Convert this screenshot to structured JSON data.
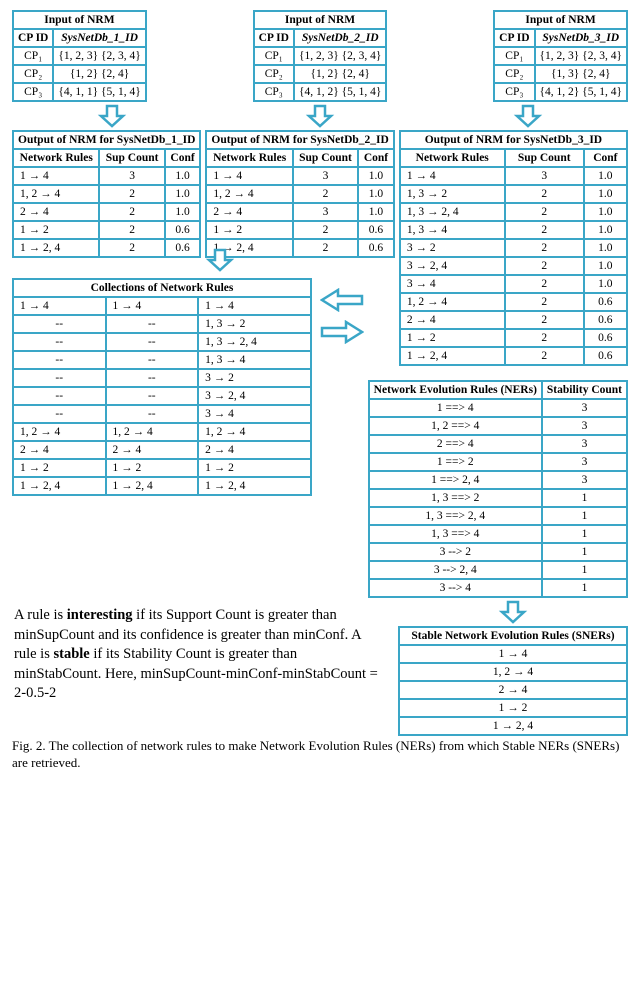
{
  "inputTables": [
    {
      "title": "Input of NRM",
      "col1": "CP ID",
      "col2": "SysNetDb_1_ID",
      "rows": [
        {
          "cp": "CP₁",
          "val": "{1, 2, 3} {2, 3, 4}"
        },
        {
          "cp": "CP₂",
          "val": "{1, 2} {2, 4}"
        },
        {
          "cp": "CP₃",
          "val": "{4, 1, 1} {5, 1, 4}"
        }
      ]
    },
    {
      "title": "Input of NRM",
      "col1": "CP ID",
      "col2": "SysNetDb_2_ID",
      "rows": [
        {
          "cp": "CP₁",
          "val": "{1, 2, 3} {2, 3, 4}"
        },
        {
          "cp": "CP₂",
          "val": "{1, 2} {2, 4}"
        },
        {
          "cp": "CP₃",
          "val": "{4, 1, 2} {5, 1, 4}"
        }
      ]
    },
    {
      "title": "Input of NRM",
      "col1": "CP ID",
      "col2": "SysNetDb_3_ID",
      "rows": [
        {
          "cp": "CP₁",
          "val": "{1, 2, 3} {2, 3, 4}"
        },
        {
          "cp": "CP₂",
          "val": "{1, 3} {2, 4}"
        },
        {
          "cp": "CP₃",
          "val": "{4, 1, 2} {5, 1, 4}"
        }
      ]
    }
  ],
  "outputTables": [
    {
      "title": "Output of NRM for SysNetDb_1_ID",
      "headers": [
        "Network Rules",
        "Sup Count",
        "Conf"
      ],
      "rows": [
        {
          "r": "1 → 4",
          "s": "3",
          "c": "1.0"
        },
        {
          "r": "1, 2 → 4",
          "s": "2",
          "c": "1.0"
        },
        {
          "r": "2 → 4",
          "s": "2",
          "c": "1.0"
        },
        {
          "r": "1 → 2",
          "s": "2",
          "c": "0.6"
        },
        {
          "r": "1 → 2, 4",
          "s": "2",
          "c": "0.6"
        }
      ]
    },
    {
      "title": "Output of NRM for SysNetDb_2_ID",
      "headers": [
        "Network Rules",
        "Sup Count",
        "Conf"
      ],
      "rows": [
        {
          "r": "1 → 4",
          "s": "3",
          "c": "1.0"
        },
        {
          "r": "1, 2 → 4",
          "s": "2",
          "c": "1.0"
        },
        {
          "r": "2 → 4",
          "s": "3",
          "c": "1.0"
        },
        {
          "r": "1 → 2",
          "s": "2",
          "c": "0.6"
        },
        {
          "r": "1 → 2, 4",
          "s": "2",
          "c": "0.6"
        }
      ]
    },
    {
      "title": "Output of NRM for SysNetDb_3_ID",
      "headers": [
        "Network Rules",
        "Sup Count",
        "Conf"
      ],
      "rows": [
        {
          "r": "1 → 4",
          "s": "3",
          "c": "1.0"
        },
        {
          "r": "1, 3 → 2",
          "s": "2",
          "c": "1.0"
        },
        {
          "r": "1, 3 → 2, 4",
          "s": "2",
          "c": "1.0"
        },
        {
          "r": "1, 3 → 4",
          "s": "2",
          "c": "1.0"
        },
        {
          "r": "3 → 2",
          "s": "2",
          "c": "1.0"
        },
        {
          "r": "3 → 2, 4",
          "s": "2",
          "c": "1.0"
        },
        {
          "r": "3 → 4",
          "s": "2",
          "c": "1.0"
        },
        {
          "r": "1, 2 → 4",
          "s": "2",
          "c": "0.6"
        },
        {
          "r": "2 → 4",
          "s": "2",
          "c": "0.6"
        },
        {
          "r": "1 → 2",
          "s": "2",
          "c": "0.6"
        },
        {
          "r": "1 → 2, 4",
          "s": "2",
          "c": "0.6"
        }
      ]
    }
  ],
  "collections": {
    "title": "Collections of Network Rules",
    "rows": [
      [
        "1 → 4",
        "1 → 4",
        "1 → 4"
      ],
      [
        "--",
        "--",
        "1, 3 → 2"
      ],
      [
        "--",
        "--",
        "1, 3 → 2, 4"
      ],
      [
        "--",
        "--",
        "1, 3 → 4"
      ],
      [
        "--",
        "--",
        "3 → 2"
      ],
      [
        "--",
        "--",
        "3 → 2, 4"
      ],
      [
        "--",
        "--",
        "3 → 4"
      ],
      [
        "1, 2 → 4",
        "1, 2 → 4",
        "1, 2 → 4"
      ],
      [
        "2 → 4",
        "2 → 4",
        "2 → 4"
      ],
      [
        "1 → 2",
        "1 → 2",
        "1 → 2"
      ],
      [
        "1 → 2, 4",
        "1 → 2, 4",
        "1 → 2, 4"
      ]
    ]
  },
  "ners": {
    "h1": "Network Evolution Rules (NERs)",
    "h2": "Stability Count",
    "rows": [
      {
        "r": "1 ==> 4",
        "c": "3"
      },
      {
        "r": "1, 2 ==> 4",
        "c": "3"
      },
      {
        "r": "2 ==> 4",
        "c": "3"
      },
      {
        "r": "1 ==> 2",
        "c": "3"
      },
      {
        "r": "1 ==> 2, 4",
        "c": "3"
      },
      {
        "r": "1, 3 ==> 2",
        "c": "1"
      },
      {
        "r": "1, 3 ==> 2, 4",
        "c": "1"
      },
      {
        "r": "1, 3 ==> 4",
        "c": "1"
      },
      {
        "r": "3 --> 2",
        "c": "1"
      },
      {
        "r": "3 --> 2, 4",
        "c": "1"
      },
      {
        "r": "3 --> 4",
        "c": "1"
      }
    ]
  },
  "sners": {
    "title": "Stable Network Evolution Rules (SNERs)",
    "rows": [
      "1 → 4",
      "1, 2 → 4",
      "2 → 4",
      "1 → 2",
      "1 → 2, 4"
    ]
  },
  "note": {
    "l1": "A rule is ",
    "b1": "interesting",
    "l2": " if its Support Count is greater than minSupCount and its confidence is greater than minConf. A rule is ",
    "b2": "stable",
    "l3": " if its Stability Count is greater than minStabCount. Here, minSupCount-minConf-minStabCount = 2-0.5-2"
  },
  "caption": "Fig. 2. The collection of network rules to make Network Evolution Rules (NERs) from which Stable NERs (SNERs) are retrieved."
}
